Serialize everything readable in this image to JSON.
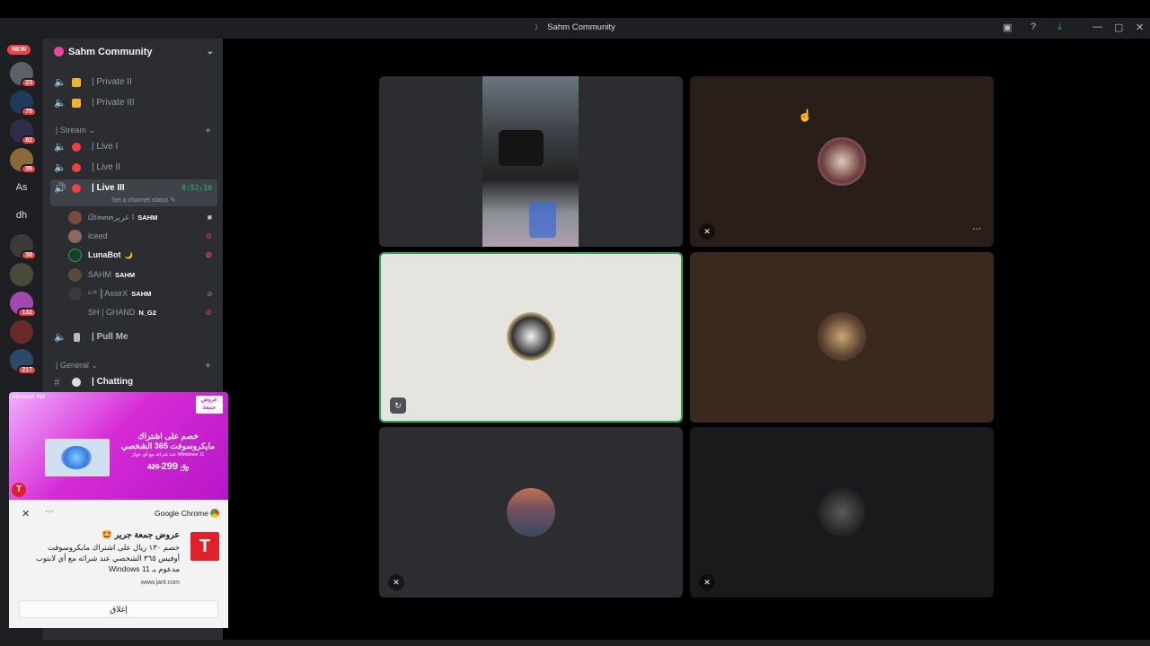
{
  "window": {
    "title": "Sahm Community",
    "controls": [
      "inbox-icon",
      "help-icon",
      "download-icon",
      "minimize-icon",
      "maximize-icon",
      "close-icon"
    ]
  },
  "guilds": {
    "new_label": "NEW",
    "items": [
      {
        "name": "guild-1",
        "badge": "23",
        "color": "#5c6068"
      },
      {
        "name": "guild-2",
        "badge": "75",
        "color": "#1f3a5a"
      },
      {
        "name": "guild-3",
        "badge": "82",
        "color": "#2e2e4a"
      },
      {
        "name": "guild-4",
        "badge": "35",
        "color": "#8a6a3a"
      },
      {
        "name": "guild-as",
        "text": "As"
      },
      {
        "name": "guild-dh",
        "text": "dh"
      },
      {
        "name": "guild-5",
        "badge": "38",
        "color": "#3b3b3b"
      },
      {
        "name": "guild-6",
        "badge": "",
        "color": "#4a4a3a"
      },
      {
        "name": "guild-7",
        "badge": "132",
        "color": "#a04ab0"
      },
      {
        "name": "guild-8",
        "badge": "",
        "color": "#6a2a2a"
      },
      {
        "name": "guild-9",
        "badge": "217",
        "color": "#2a4a6a"
      }
    ]
  },
  "sidebar": {
    "server_name": "Sahm Community",
    "channels_top": [
      {
        "label": "| Private II",
        "icon": "lock-icon"
      },
      {
        "label": "| Private III",
        "icon": "lock-icon"
      }
    ],
    "stream_category": "| Stream",
    "stream_channels": [
      {
        "label": "| Live I"
      },
      {
        "label": "| Live II"
      },
      {
        "label": "| Live III",
        "timer": "8:52:16"
      }
    ],
    "status_hint": "Set a channel status",
    "voice_users": [
      {
        "name": "i3r๓๓๓ا عرير",
        "tag": "SAHM",
        "icon": "camera-icon"
      },
      {
        "name": "iceed",
        "tag": "",
        "icon": "deafen-icon"
      },
      {
        "name": "LunaBot",
        "tag": "🌙",
        "icon": "deafen-icon",
        "bot": true
      },
      {
        "name": "SAHM",
        "tag": "SAHM",
        "icon": ""
      },
      {
        "name": "ˢ ᴴ ║AssirX",
        "tag": "SAHM",
        "icon": "mute-icon"
      },
      {
        "name": "SH | GHAND",
        "tag": "N_G2",
        "icon": "deafen-icon"
      }
    ],
    "pull_me": "| Pull Me",
    "general_category": "| General",
    "chatting": "| Chatting"
  },
  "ad": {
    "brand": "Microsoft 365",
    "badge_line1": "عروض",
    "badge_line2": "جمعة",
    "headline1": "خصم على اشتراك",
    "headline2": "مايكروسوفت 365 الشخصي",
    "subline": "عند شرائه مع أي جهاز Windows 11",
    "new_price": "299",
    "old_price": "429 ﷼"
  },
  "notification": {
    "app": "Google Chrome",
    "title": "عروض جمعة جرير 🤩",
    "body1": "خصم ١٣٠ ريال على اشتراك مايكروسوفت",
    "body2": "أوفيس ٣٦٥ الشخصي عند شرائه مع أي لابتوب",
    "body3": "مدعوم بـ Windows 11",
    "source": "www.jarir.com",
    "close_button": "إغلاق"
  },
  "colors": {
    "accent_green": "#23a55a",
    "danger": "#f23f43",
    "brand": "#5865f2"
  }
}
